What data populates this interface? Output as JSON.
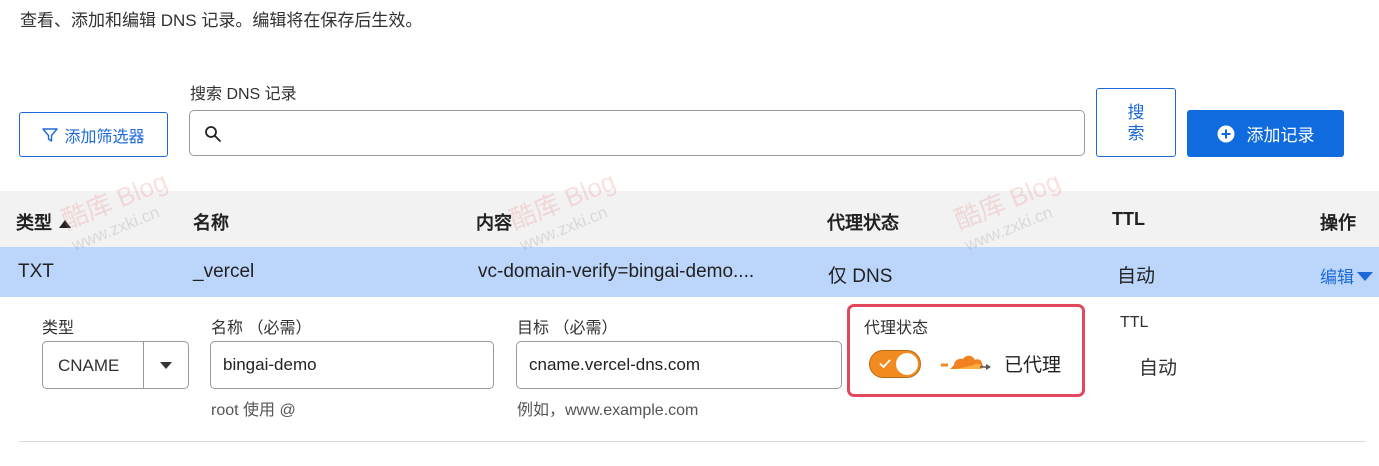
{
  "description": "查看、添加和编辑 DNS 记录。编辑将在保存后生效。",
  "toolbar": {
    "filter_label": "添加筛选器",
    "search_label": "搜索 DNS 记录",
    "search_value": "",
    "search_button": "搜索",
    "add_record": "添加记录"
  },
  "table": {
    "headers": {
      "type": "类型",
      "name": "名称",
      "content": "内容",
      "proxy": "代理状态",
      "ttl": "TTL",
      "actions": "操作"
    },
    "row": {
      "type": "TXT",
      "name": "_vercel",
      "content": "vc-domain-verify=bingai-demo....",
      "proxy": "仅 DNS",
      "ttl": "自动",
      "edit": "编辑"
    }
  },
  "edit_form": {
    "type_label": "类型",
    "type_value": "CNAME",
    "name_label": "名称 （必需）",
    "name_value": "bingai-demo",
    "name_hint": "root 使用 @",
    "target_label": "目标 （必需）",
    "target_value": "cname.vercel-dns.com",
    "target_hint": "例如，www.example.com",
    "proxy_label": "代理状态",
    "proxy_enabled": true,
    "proxy_text": "已代理",
    "ttl_label": "TTL",
    "ttl_value": "自动"
  },
  "watermark": {
    "logo": "酷库 Blog",
    "site": "www.zxki.cn"
  },
  "colors": {
    "accent": "#1d68d9",
    "row_highlight": "#bcd6fb",
    "toggle_on": "#f18a1f",
    "highlight_box": "#e2475e"
  }
}
